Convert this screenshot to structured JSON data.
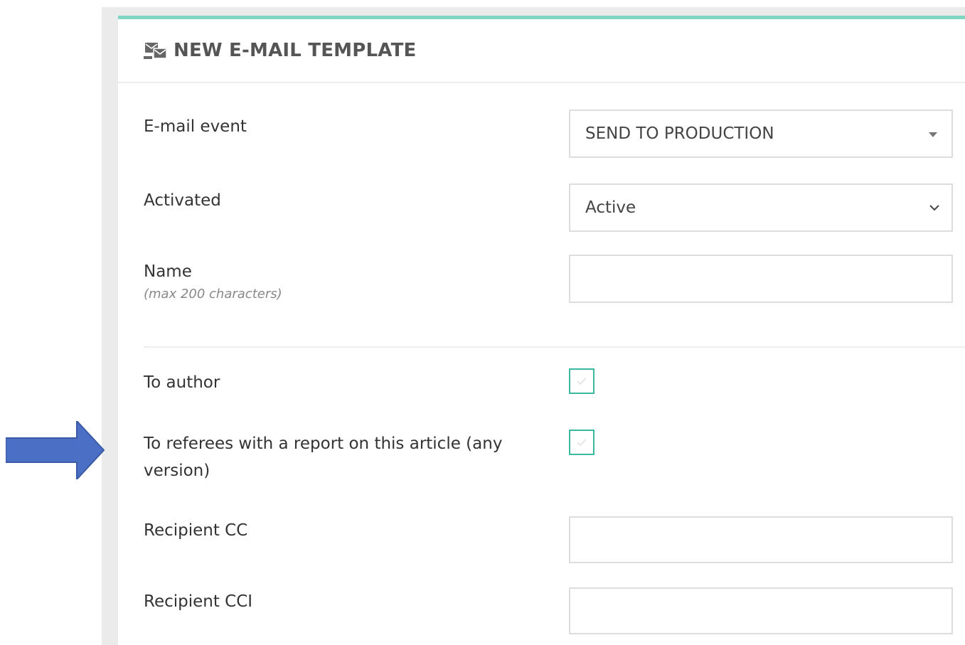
{
  "header": {
    "title": "NEW E-MAIL TEMPLATE",
    "icon": "email-template-icon"
  },
  "form": {
    "email_event": {
      "label": "E-mail event",
      "value": "SEND TO PRODUCTION"
    },
    "activated": {
      "label": "Activated",
      "value": "Active"
    },
    "name": {
      "label": "Name",
      "hint": "(max 200 characters)",
      "value": ""
    },
    "to_author": {
      "label": "To author",
      "checked": false
    },
    "to_referees": {
      "label": "To referees with a report on this article (any version)",
      "checked": false
    },
    "recipient_cc": {
      "label": "Recipient CC",
      "value": ""
    },
    "recipient_cci": {
      "label": "Recipient CCI",
      "value": ""
    }
  },
  "colors": {
    "accent": "#7fd6c2",
    "checkbox_border": "#3bb9a0",
    "arrow": "#4a6fc4"
  }
}
